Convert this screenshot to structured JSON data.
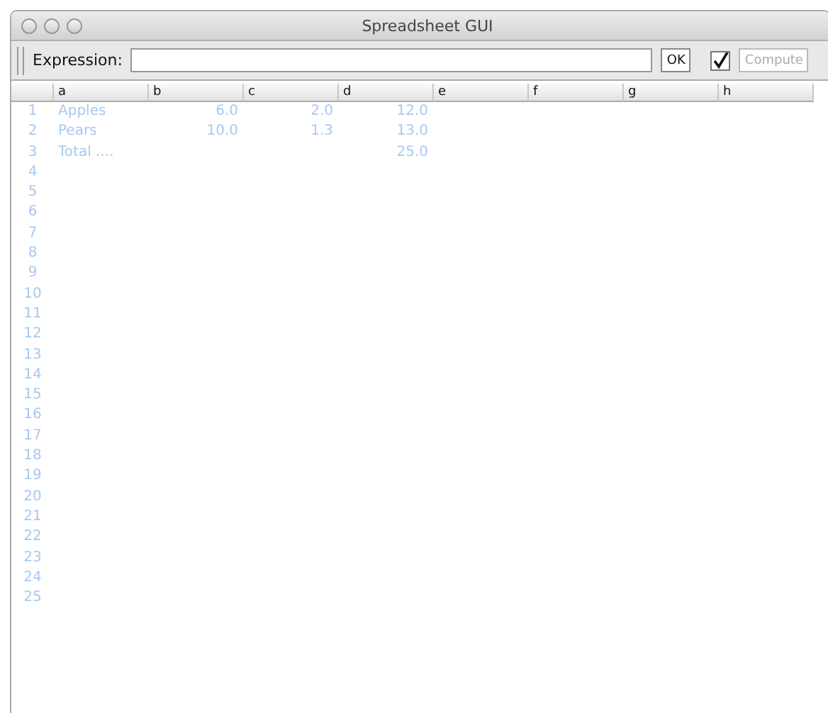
{
  "window": {
    "title": "Spreadsheet GUI"
  },
  "toolbar": {
    "expression_label": "Expression:",
    "ok_button": "OK",
    "compute_checkbox": {
      "checked": true
    },
    "compute_button": {
      "label": "Compute",
      "disabled": true
    }
  },
  "table": {
    "columns": [
      "a",
      "b",
      "c",
      "d",
      "e",
      "f",
      "g",
      "h"
    ],
    "rows": [
      {
        "number": "1",
        "cells": [
          {
            "kind": "text",
            "text": "Apples"
          },
          {
            "kind": "number",
            "text": "6.0"
          },
          {
            "kind": "number",
            "text": "2.0"
          },
          {
            "kind": "number",
            "text": "12.0"
          }
        ]
      },
      {
        "number": "2",
        "cells": [
          {
            "kind": "text",
            "text": "Pears"
          },
          {
            "kind": "number",
            "text": "10.0"
          },
          {
            "kind": "number",
            "text": "1.3"
          },
          {
            "kind": "number",
            "text": "13.0"
          }
        ]
      },
      {
        "number": "3",
        "cells": [
          {
            "kind": "text",
            "text": "Total ...."
          },
          {
            "kind": "empty"
          },
          {
            "kind": "empty"
          },
          {
            "kind": "number",
            "text": "25.0"
          }
        ]
      },
      {
        "number": "4"
      },
      {
        "number": "5"
      },
      {
        "number": "6"
      },
      {
        "number": "7"
      },
      {
        "number": "8"
      },
      {
        "number": "9"
      },
      {
        "number": "10"
      },
      {
        "number": "11"
      },
      {
        "number": "12"
      },
      {
        "number": "13"
      },
      {
        "number": "14"
      },
      {
        "number": "15"
      },
      {
        "number": "16"
      },
      {
        "number": "17"
      },
      {
        "number": "18"
      },
      {
        "number": "19"
      },
      {
        "number": "20"
      },
      {
        "number": "21"
      },
      {
        "number": "22"
      },
      {
        "number": "23"
      },
      {
        "number": "24"
      },
      {
        "number": "25"
      }
    ]
  }
}
